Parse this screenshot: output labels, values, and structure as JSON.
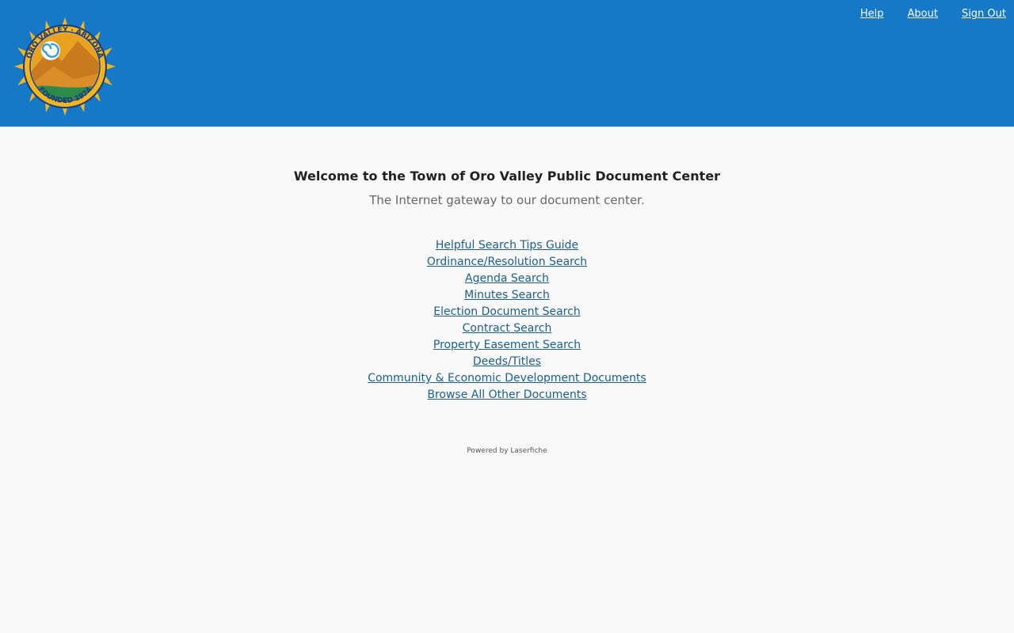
{
  "header": {
    "background": "#1679c8",
    "logo": {
      "ring_text_top": "ORO VALLEY · ARIZONA",
      "ring_text_bottom": "FOUNDED 1974",
      "icon": "town-seal-icon"
    },
    "nav": [
      {
        "label": "Help"
      },
      {
        "label": "About"
      },
      {
        "label": "Sign Out"
      }
    ]
  },
  "main": {
    "welcome": "Welcome to the Town of Oro Valley Public Document Center",
    "tagline": "The Internet gateway to our document center.",
    "links": [
      {
        "label": "Helpful Search Tips Guide"
      },
      {
        "label": "Ordinance/Resolution Search"
      },
      {
        "label": "Agenda Search"
      },
      {
        "label": "Minutes Search"
      },
      {
        "label": "Election Document Search"
      },
      {
        "label": "Contract Search"
      },
      {
        "label": "Property Easement Search"
      },
      {
        "label": "Deeds/Titles"
      },
      {
        "label": "Community & Economic Development Documents"
      },
      {
        "label": "Browse All Other Documents"
      }
    ],
    "powered_by": "Powered by Laserfiche"
  }
}
